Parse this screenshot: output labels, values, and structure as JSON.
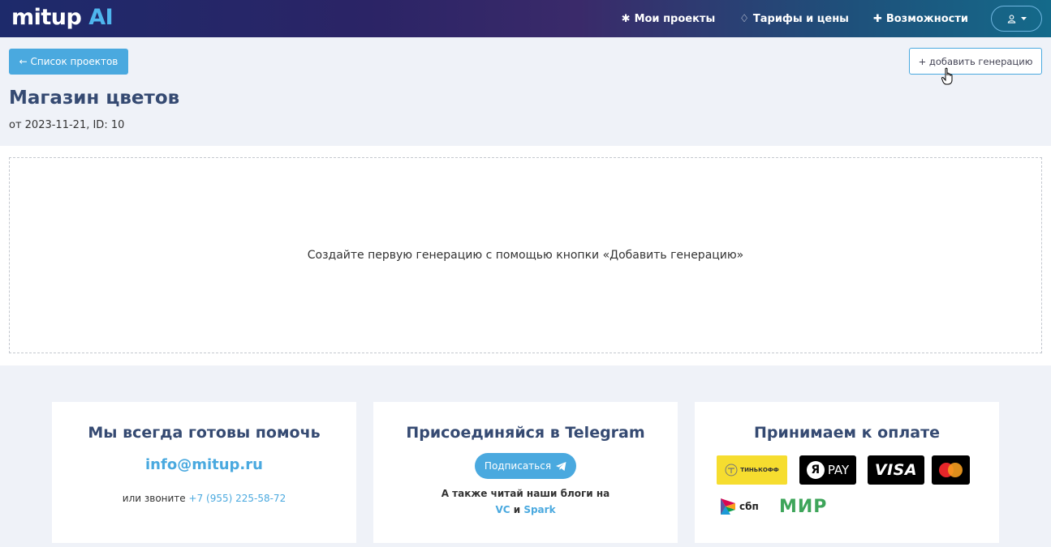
{
  "navbar": {
    "logo_main": "mitup",
    "logo_ai": "AI",
    "links": [
      {
        "icon": "asterisk-icon",
        "glyph": "✱",
        "label": "Мои проекты"
      },
      {
        "icon": "diamond-icon",
        "glyph": "♢",
        "label": "Тарифы и цены"
      },
      {
        "icon": "plus-icon",
        "glyph": "✚",
        "label": "Возможности"
      }
    ]
  },
  "header": {
    "back_label": "← Список проектов",
    "add_label": "+ добавить генерацию",
    "title": "Магазин цветов",
    "meta": "от 2023-11-21,  ID: 10"
  },
  "main": {
    "empty_text": "Создайте первую генерацию с помощью кнопки «Добавить генерацию»"
  },
  "footer": {
    "help": {
      "title": "Мы всегда готовы помочь",
      "email": "info@mitup.ru",
      "call_prefix": "или звоните",
      "phone": "+7 (955) 225-58-72"
    },
    "telegram": {
      "title": "Присоединяйся в Telegram",
      "subscribe_label": "Подписаться",
      "blogs_text": "А также читай наши блоги на",
      "vc": "VC",
      "and": "и",
      "spark": "Spark"
    },
    "payment": {
      "title": "Принимаем к оплате",
      "tinkoff": "ТИНЬКОФФ",
      "yapay_logo": "Я",
      "yapay": "PAY",
      "visa": "VISA",
      "sbp": "сбп",
      "mir": "МИР"
    }
  },
  "colors": {
    "accent": "#4aa9df",
    "title": "#354a72",
    "tinkoff_yellow": "#f6dd2f",
    "mir_green": "#3ea55a"
  }
}
